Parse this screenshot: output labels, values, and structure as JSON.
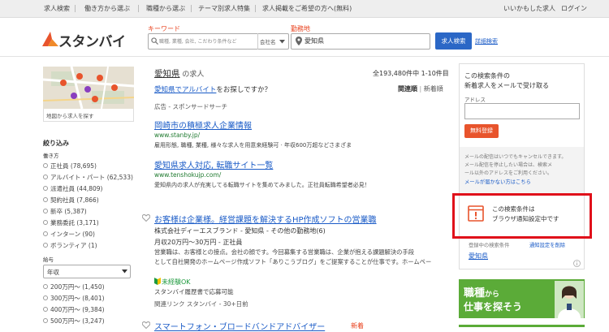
{
  "topnav": {
    "items": [
      "求人検索",
      "働き方から選ぶ",
      "職種から選ぶ",
      "テーマ別求人特集",
      "求人掲載をご希望の方へ(無料)"
    ],
    "right_items": [
      "いいかもした求人",
      "ログイン"
    ]
  },
  "header": {
    "logo_text": "スタンバイ",
    "keyword_label": "キーワード",
    "keyword_placeholder": "職種, 業種, 会社, こだわり条件など",
    "company_select": "会社名",
    "location_label": "勤務地",
    "location_value": "愛知県",
    "search_button": "求人検索",
    "detail_link": "詳細検索"
  },
  "left": {
    "map_caption": "地図から求人を探す",
    "filter_title": "絞り込み",
    "employment_label": "働き方",
    "employment": [
      "正社員 (78,695)",
      "アルバイト・パート (62,533)",
      "派遣社員 (44,809)",
      "契約社員 (7,866)",
      "新卒 (5,387)",
      "業務委託 (3,171)",
      "インターン (90)",
      "ボランティア (1)"
    ],
    "salary_label": "給与",
    "salary_select": "年収",
    "salary_options": [
      "200万円～ (1,450)",
      "300万円～ (8,401)",
      "400万円～ (9,384)",
      "500万円～ (3,247)"
    ]
  },
  "main": {
    "heading_place": "愛知県",
    "heading_suffix": " の求人",
    "count": "全193,480件中 1-10件目",
    "subheading_link": "愛知県でアルバイト",
    "subheading_rest": "をお探しですか？",
    "sort_relevance": "関連順",
    "sort_divider": " | ",
    "sort_new": "新着順",
    "ad_label": "広告 - スポンサードサーチ",
    "ads": [
      {
        "title": "岡崎市の積極求人企業情報",
        "url": "www.stanby.jp/",
        "desc": "雇用形態, 職種, 業種, 様々な求人を用意来経験可 · 年収600万超などさまざま"
      },
      {
        "title": "愛知県求人対応, 転職サイト一覧",
        "url": "www.tenshokujp.com/",
        "desc": "愛知県内の求人が充実してる転職サイトを集めてみました。正社員転職希望者必見！"
      }
    ],
    "job": {
      "title": "お客様は企業様。経営課題を解決するHP作成ソフトの営業職",
      "company": "株式会社ディーエスブランド - 愛知県 - その他の勤務地(6)",
      "salary": "月収20万円～30万円 - 正社員",
      "desc1": "営業職は、お客様との接点。会社の顔です。今回募集する営業職は、企業が抱える課題解決の手段",
      "desc2": "として自社開発のホームページ作成ソフト「ありこうブログ」をご提案することが仕事です。ホームペー",
      "badge": "未経験OK",
      "apply": "スタンバイ履歴書で応募可能",
      "related": "関連リンク  スタンバイ - 30+日前"
    },
    "job2_title": "スマートフォン・ブロードバンドアドバイザー",
    "job2_new": "新着"
  },
  "right": {
    "alert_title1": "この検索条件の",
    "alert_title2": "新着求人をメールで受け取る",
    "address_label": "アドレス",
    "register_button": "無料登録",
    "note1": "メールの配信はいつでもキャンセルできます。",
    "note2": "メール配信を停止したい場合は、検索メ",
    "note3": "ール以外のアドレスをご利用ください。",
    "note_link": "メールが届かない方はこちら",
    "notify_line1": "この検索条件は",
    "notify_line2": "ブラウザ通知設定中です",
    "saved_label": "登録中の検索条件",
    "saved_action": "通知設定を削除",
    "saved_value": "愛知県",
    "banner_line1": "職種",
    "banner_kara": "から",
    "banner_line2": "仕事を探そう"
  }
}
